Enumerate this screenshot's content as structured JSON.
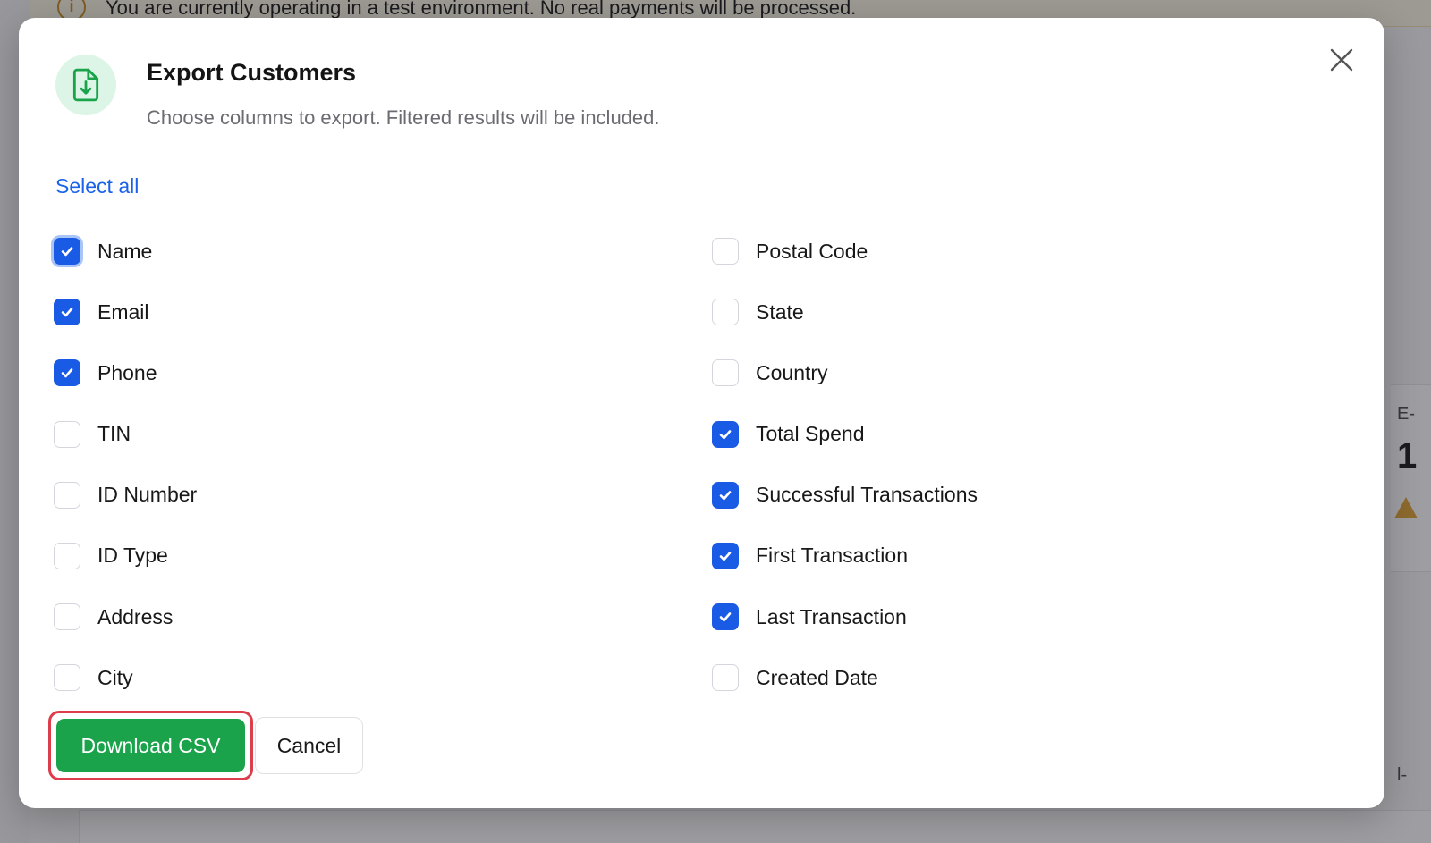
{
  "background": {
    "banner_text": "You are currently operating in a test environment. No real payments will be processed.",
    "info_icon": "info-icon",
    "fragments": [
      "E-",
      "1",
      "l-"
    ]
  },
  "modal": {
    "icon": "file-download-icon",
    "title": "Export Customers",
    "subtitle": "Choose columns to export. Filtered results will be included.",
    "close_icon": "close-icon",
    "select_all_label": "Select all",
    "columns_left": [
      {
        "label": "Name",
        "checked": true
      },
      {
        "label": "Email",
        "checked": true
      },
      {
        "label": "Phone",
        "checked": true
      },
      {
        "label": "TIN",
        "checked": false
      },
      {
        "label": "ID Number",
        "checked": false
      },
      {
        "label": "ID Type",
        "checked": false
      },
      {
        "label": "Address",
        "checked": false
      },
      {
        "label": "City",
        "checked": false
      }
    ],
    "columns_right": [
      {
        "label": "Postal Code",
        "checked": false
      },
      {
        "label": "State",
        "checked": false
      },
      {
        "label": "Country",
        "checked": false
      },
      {
        "label": "Total Spend",
        "checked": true
      },
      {
        "label": "Successful Transactions",
        "checked": true
      },
      {
        "label": "First Transaction",
        "checked": true
      },
      {
        "label": "Last Transaction",
        "checked": true
      },
      {
        "label": "Created Date",
        "checked": false
      }
    ],
    "download_label": "Download CSV",
    "cancel_label": "Cancel"
  },
  "colors": {
    "accent_blue": "#1a5be6",
    "download_green": "#1aa34a",
    "highlight_red": "#dc3e4c",
    "icon_bg": "#dcf5e6",
    "icon_green": "#1aa34a"
  }
}
